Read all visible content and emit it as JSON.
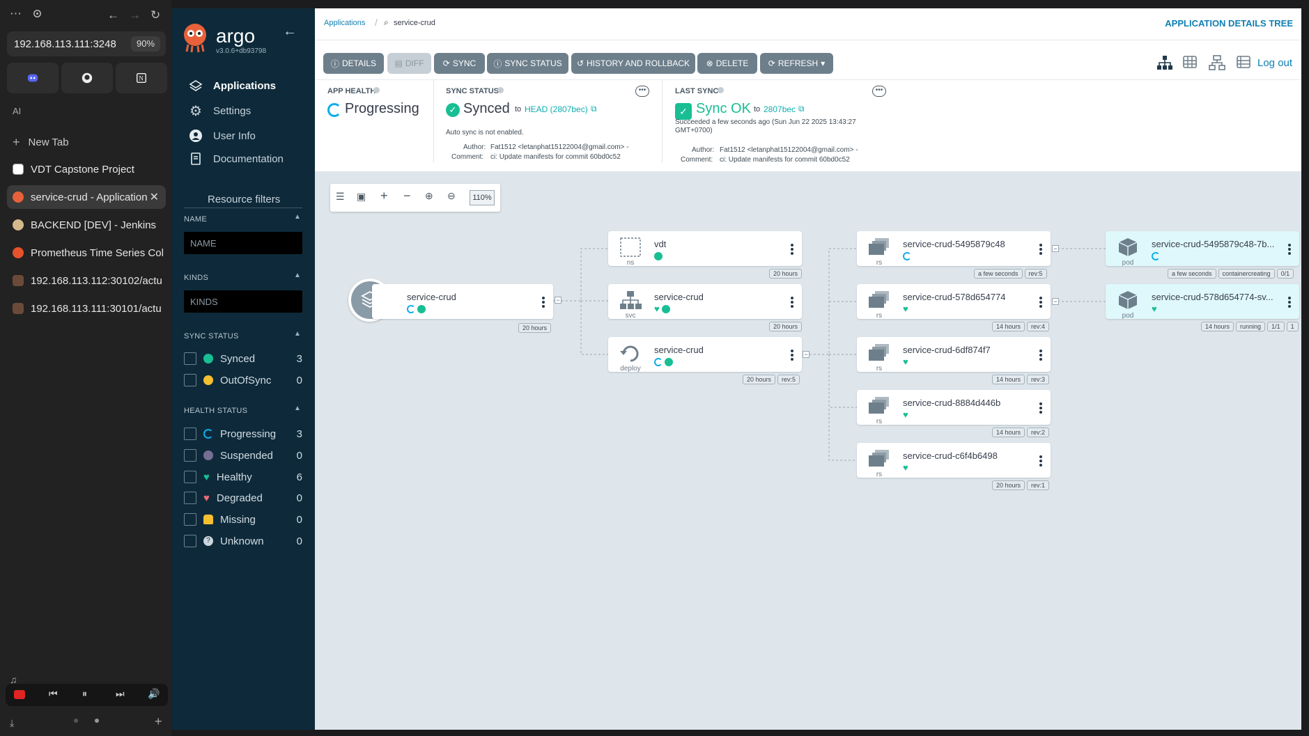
{
  "browser": {
    "url": "192.168.113.111:3248",
    "zoom": "90%",
    "section_label": "AI",
    "new_tab": "New Tab",
    "tabs": [
      {
        "label": "VDT Capstone Project",
        "icon": "notion-icon"
      },
      {
        "label": "service-crud - Application",
        "icon": "argo-icon"
      },
      {
        "label": "BACKEND [DEV] - Jenkins",
        "icon": "jenkins-icon"
      },
      {
        "label": "Prometheus Time Series Col",
        "icon": "prometheus-icon"
      },
      {
        "label": "192.168.113.112:30102/actu",
        "icon": "page-icon"
      },
      {
        "label": "192.168.113.111:30101/actu",
        "icon": "page-icon"
      }
    ],
    "pinned": [
      "discord-icon",
      "github-icon",
      "notion-icon"
    ]
  },
  "argo": {
    "logo": "argo",
    "version": "v3.0.6+db93798",
    "nav": [
      {
        "label": "Applications",
        "icon": "layers-icon"
      },
      {
        "label": "Settings",
        "icon": "gear-icon"
      },
      {
        "label": "User Info",
        "icon": "user-icon"
      },
      {
        "label": "Documentation",
        "icon": "book-icon"
      }
    ],
    "filters": {
      "title": "Resource filters",
      "name_label": "NAME",
      "name_placeholder": "NAME",
      "kinds_label": "KINDS",
      "kinds_placeholder": "KINDS",
      "sync_label": "SYNC STATUS",
      "sync": [
        {
          "label": "Synced",
          "count": "3",
          "color": "#18be94"
        },
        {
          "label": "OutOfSync",
          "count": "0",
          "color": "#f4c030"
        }
      ],
      "health_label": "HEALTH STATUS",
      "health": [
        {
          "label": "Progressing",
          "count": "3",
          "color": "#0dadea"
        },
        {
          "label": "Suspended",
          "count": "0",
          "color": "#766f94"
        },
        {
          "label": "Healthy",
          "count": "6",
          "color": "#18be94"
        },
        {
          "label": "Degraded",
          "count": "0",
          "color": "#e96d76"
        },
        {
          "label": "Missing",
          "count": "0",
          "color": "#f4c030"
        },
        {
          "label": "Unknown",
          "count": "0",
          "color": "#ccd6dd"
        }
      ]
    }
  },
  "header": {
    "breadcrumb": "Applications",
    "app": "service-crud",
    "page_title": "APPLICATION DETAILS TREE",
    "logout": "Log out"
  },
  "toolbar": {
    "details": "DETAILS",
    "diff": "DIFF",
    "sync": "SYNC",
    "sync_status": "SYNC STATUS",
    "history": "HISTORY AND ROLLBACK",
    "delete": "DELETE",
    "refresh": "REFRESH"
  },
  "status": {
    "app_health_label": "APP HEALTH",
    "app_health": "Progressing",
    "sync_status_label": "SYNC STATUS",
    "sync_value": "Synced",
    "sync_to": "to",
    "sync_rev": "HEAD (2807bec)",
    "auto_sync": "Auto sync is not enabled.",
    "author_label": "Author:",
    "author": "Fat1512 <letanphat15122004@gmail.com> -",
    "comment_label": "Comment:",
    "comment": "ci: Update manifests for commit 60bd0c52",
    "last_sync_label": "LAST SYNC",
    "last_sync_value": "Sync OK",
    "last_sync_to": "to",
    "last_sync_rev": "2807bec",
    "succeeded_line1": "Succeeded a few seconds ago (Sun Jun 22 2025 13:43:27",
    "succeeded_line2": "GMT+0700)",
    "last_author": "Fat1512 <letanphat15122004@gmail.com> -",
    "last_comment": "ci: Update manifests for commit 60bd0c52"
  },
  "graph": {
    "zoom": "110%",
    "root": {
      "name": "service-crud",
      "age": "20 hours"
    },
    "level1": [
      {
        "name": "vdt",
        "kind": "ns",
        "tags": [
          "20 hours"
        ],
        "status": [
          "ok"
        ]
      },
      {
        "name": "service-crud",
        "kind": "svc",
        "tags": [
          "20 hours"
        ],
        "status": [
          "heart",
          "ok"
        ]
      },
      {
        "name": "service-crud",
        "kind": "deploy",
        "tags": [
          "20 hours",
          "rev:5"
        ],
        "status": [
          "prog",
          "ok"
        ]
      }
    ],
    "level2": [
      {
        "name": "service-crud-5495879c48",
        "kind": "rs",
        "tags": [
          "a few seconds",
          "rev:5"
        ],
        "status": [
          "prog"
        ]
      },
      {
        "name": "service-crud-578d654774",
        "kind": "rs",
        "tags": [
          "14 hours",
          "rev:4"
        ],
        "status": [
          "heart"
        ]
      },
      {
        "name": "service-crud-6df874f7",
        "kind": "rs",
        "tags": [
          "14 hours",
          "rev:3"
        ],
        "status": [
          "heart"
        ]
      },
      {
        "name": "service-crud-8884d446b",
        "kind": "rs",
        "tags": [
          "14 hours",
          "rev:2"
        ],
        "status": [
          "heart"
        ]
      },
      {
        "name": "service-crud-c6f4b6498",
        "kind": "rs",
        "tags": [
          "20 hours",
          "rev:1"
        ],
        "status": [
          "heart"
        ]
      }
    ],
    "level3": [
      {
        "name": "service-crud-5495879c48-7b...",
        "kind": "pod",
        "tags": [
          "a few seconds",
          "containercreating",
          "0/1"
        ],
        "status": [
          "prog"
        ]
      },
      {
        "name": "service-crud-578d654774-sv...",
        "kind": "pod",
        "tags": [
          "14 hours",
          "running",
          "1/1",
          "1"
        ],
        "status": [
          "heart"
        ]
      }
    ]
  }
}
